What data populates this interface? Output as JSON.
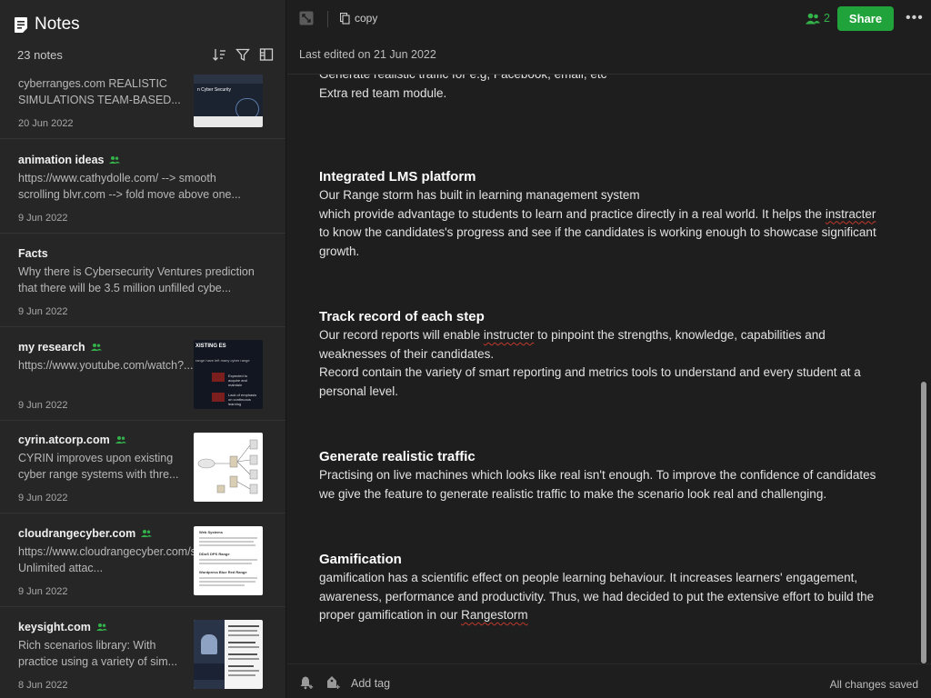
{
  "sidebar": {
    "title": "Notes",
    "count": "23 notes",
    "notes": [
      {
        "title": "",
        "body": "cyberranges.com REALISTIC SIMULATIONS TEAM-BASED...",
        "date": "20 Jun 2022",
        "shared": false
      },
      {
        "title": "animation ideas",
        "body": "https://www.cathydolle.com/ --> smooth scrolling blvr.com --> fold move above one...",
        "date": "9 Jun 2022",
        "shared": true
      },
      {
        "title": "Facts",
        "body": "Why there is Cybersecurity Ventures prediction that there will be 3.5 million unfilled cybe...",
        "date": "9 Jun 2022",
        "shared": false
      },
      {
        "title": "my research",
        "body": "https://www.youtube.com/watch?...",
        "date": "9 Jun 2022",
        "shared": true
      },
      {
        "title": "cyrin.atcorp.com",
        "body": "CYRIN improves upon existing cyber range systems with thre...",
        "date": "9 Jun 2022",
        "shared": true
      },
      {
        "title": "cloudrangecyber.com",
        "body": "https://www.cloudrangecyber.com/scenarios Unlimited attac...",
        "date": "9 Jun 2022",
        "shared": true
      },
      {
        "title": "keysight.com",
        "body": "Rich scenarios library: With practice using a variety of sim...",
        "date": "8 Jun 2022",
        "shared": true
      }
    ],
    "thumb_text": {
      "t0": "n Cyber Security",
      "t3": "XISTING ES",
      "t3_body": "range have left many cyber range",
      "t3_a": "Expected to acquire and maintain",
      "t3_b": "Lack of emphasis on continuous learning",
      "t5": "Web Systems",
      "t5_b": "DDoS DPS Range",
      "t5_c": "Wordpress Blue Red Range"
    }
  },
  "toolbar": {
    "copy_label": "copy",
    "collaborators": "2",
    "share_label": "Share",
    "more_label": "•••",
    "last_edited": "Last edited on 21 Jun 2022"
  },
  "content": {
    "intro_line1": "Generate realistic traffic for e.g; Facebook, email, etc",
    "intro_line2": "Extra red team module.",
    "s1_heading": "Integrated LMS platform",
    "s1_p1": "Our Range storm has built in learning management system",
    "s1_p2a": "which provide advantage to students to learn and practice directly in a real world. It helps the ",
    "s1_p2b": "instracter",
    "s1_p2c": " to know the candidates's progress and see if the candidates is working enough to showcase significant growth.",
    "s2_heading": "Track record of each step",
    "s2_p1a": "Our record reports will enable ",
    "s2_p1b": "instructer",
    "s2_p1c": " to pinpoint the strengths, knowledge, capabilities and weaknesses of their candidates.",
    "s2_p2": "Record contain the variety of smart reporting and metrics tools to understand and every student at a personal level.",
    "s3_heading": "Generate realistic traffic",
    "s3_p1": "Practising on live machines which looks like real isn't enough. To improve the confidence of candidates we give the feature to generate realistic traffic to make the scenario look real and challenging.",
    "s4_heading": "Gamification",
    "s4_p1a": "gamification has a scientific effect on people learning behaviour. It increases learners' engagement, awareness, performance and productivity. Thus, we had decided to put the extensive effort to build the proper gamification in our ",
    "s4_p1b": "Rangestorm"
  },
  "footer": {
    "add_tag": "Add tag",
    "status": "All changes saved"
  },
  "colors": {
    "accent_green": "#1fa33a",
    "shared_green": "#33b24a",
    "sidebar_bg": "#262626",
    "editor_bg": "#1e1e1e"
  },
  "icons": {
    "app": "note-icon",
    "sort": "sort-icon",
    "filter": "filter-icon",
    "view": "layout-icon",
    "expand": "expand-icon",
    "copy": "copy-icon",
    "users": "users-icon",
    "bell": "reminder-icon",
    "tag": "tag-icon"
  }
}
